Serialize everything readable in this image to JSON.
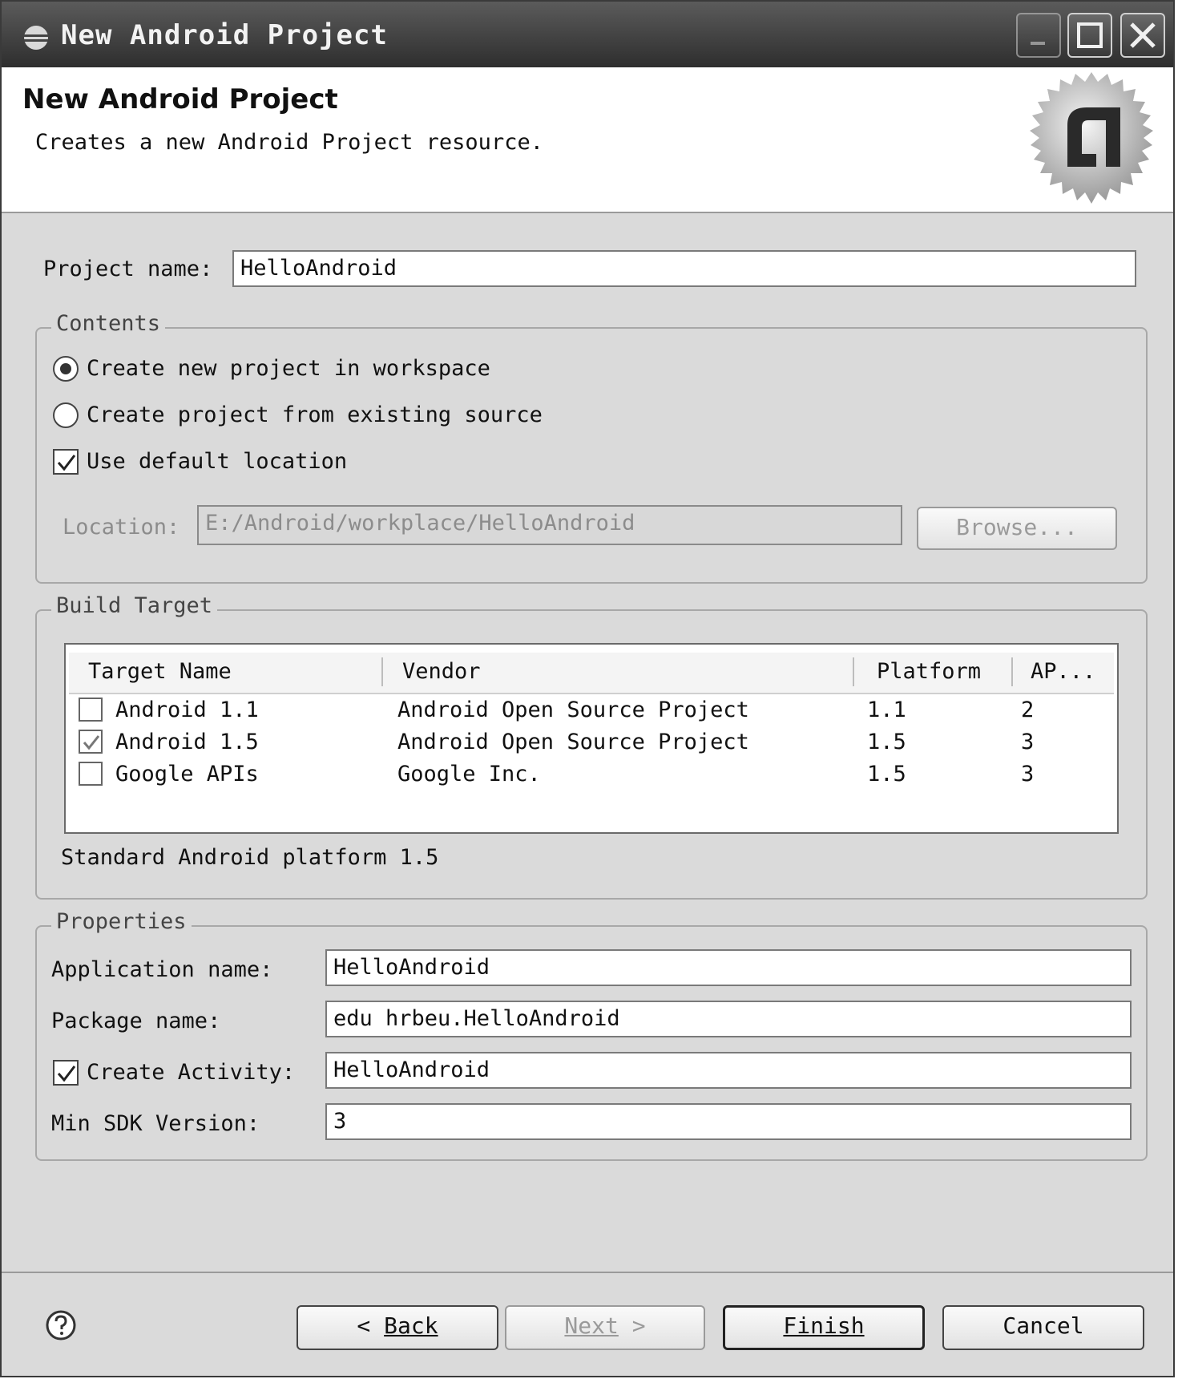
{
  "window": {
    "title": "New Android Project"
  },
  "banner": {
    "title": "New Android Project",
    "description": "Creates a new Android Project resource.",
    "logo_icon": "android-logo-icon"
  },
  "project": {
    "name_label": "Project name:",
    "name_value": "HelloAndroid"
  },
  "contents": {
    "group_label": "Contents",
    "options": [
      {
        "label": "Create new project in workspace",
        "selected": true
      },
      {
        "label": "Create project from existing source",
        "selected": false
      }
    ],
    "use_default_location": {
      "label": "Use default location",
      "checked": true
    },
    "location_label": "Location:",
    "location_value": "E:/Android/workplace/HelloAndroid",
    "browse_label": "Browse..."
  },
  "build_target": {
    "group_label": "Build Target",
    "columns": [
      "Target Name",
      "Vendor",
      "Platform",
      "AP..."
    ],
    "rows": [
      {
        "checked": false,
        "name": "Android 1.1",
        "vendor": "Android Open Source Project",
        "platform": "1.1",
        "api": "2"
      },
      {
        "checked": true,
        "name": "Android 1.5",
        "vendor": "Android Open Source Project",
        "platform": "1.5",
        "api": "3"
      },
      {
        "checked": false,
        "name": "Google APIs",
        "vendor": "Google Inc.",
        "platform": "1.5",
        "api": "3"
      }
    ],
    "description": "Standard Android platform 1.5"
  },
  "properties": {
    "group_label": "Properties",
    "application_name_label": "Application name:",
    "application_name_value": "HelloAndroid",
    "package_name_label": "Package name:",
    "package_name_value": "edu hrbeu.HelloAndroid",
    "create_activity_label": "Create Activity:",
    "create_activity_checked": true,
    "create_activity_value": "HelloAndroid",
    "min_sdk_label": "Min SDK Version:",
    "min_sdk_value": "3"
  },
  "buttons": {
    "back": "Back",
    "next": "Next",
    "finish": "Finish",
    "cancel": "Cancel"
  }
}
